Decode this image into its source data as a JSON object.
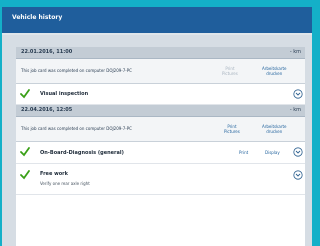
{
  "window": {
    "title": "Vehicle history"
  },
  "entries": [
    {
      "date": "22.01.2016, 11:00",
      "km": "- km",
      "message": "This job card was completed on computer DOJ209-7-PC",
      "buttons": {
        "print_pictures": "Print\nPictures",
        "print_workcard": "Arbeitskarte\ndrucken"
      },
      "tasks": [
        {
          "name": "Visual inspection"
        }
      ]
    },
    {
      "date": "22.04.2016, 12:05",
      "km": "- km",
      "message": "This job card was completed on computer DOJ209-7-PC",
      "buttons": {
        "print_pictures": "Print\nPictures",
        "print_workcard": "Arbeitskarte\ndrucken"
      },
      "tasks": [
        {
          "name": "On-Board-Diagnosis (general)",
          "print_label": "Print",
          "display_label": "Display"
        },
        {
          "name": "Free work",
          "note": "Verify one rear axle right"
        }
      ]
    }
  ],
  "colors": {
    "accent": "#1f5e9c",
    "check": "#3aa017",
    "background": "#14b0c8"
  }
}
